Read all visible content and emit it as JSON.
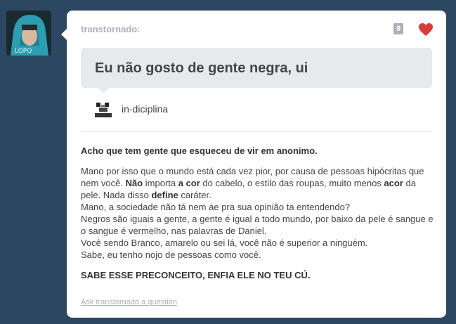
{
  "asker": {
    "name": "transtornado:"
  },
  "notes": {
    "count": "9"
  },
  "question": {
    "text": "Eu não gosto de gente negra, ui"
  },
  "answerer": {
    "name": "in-diciplina"
  },
  "answer": {
    "intro": "Acho que tem gente que esqueceu de vir em anonimo.",
    "line1_a": "Mano por isso que o mundo está cada vez pior, por causa de pessoas hipócritas que nem você. ",
    "line1_b": "Não",
    "line1_c": " importa ",
    "line1_d": "a cor",
    "line1_e": " do cabelo, o estilo das roupas, muito menos ",
    "line1_f": "acor",
    "line1_g": " da pele. Nada disso ",
    "line1_h": "define",
    "line1_i": " caráter.",
    "line2": "Mano, a sociedade não tá nem ae pra sua opinião ta entendendo?",
    "line3": "Negros são iguais a gente, a gente é igual a todo mundo, por baixo da pele é sangue e o sangue é vermelho, nas palavras de Daniel.",
    "line4": "Você sendo Branco, amarelo ou sei lá, você não é superior a ninguém.",
    "line5": "Sabe, eu tenho nojo de pessoas como você.",
    "outro": "SABE ESSE PRECONCEITO, ENFIA ELE NO TEU CÚ."
  },
  "footer": {
    "ask_link": "Ask transtornado a question"
  },
  "colors": {
    "background": "#2c4762",
    "heart": "#d93b3b",
    "muted": "#a8b1ba"
  },
  "icons": {
    "like": "heart-icon"
  }
}
